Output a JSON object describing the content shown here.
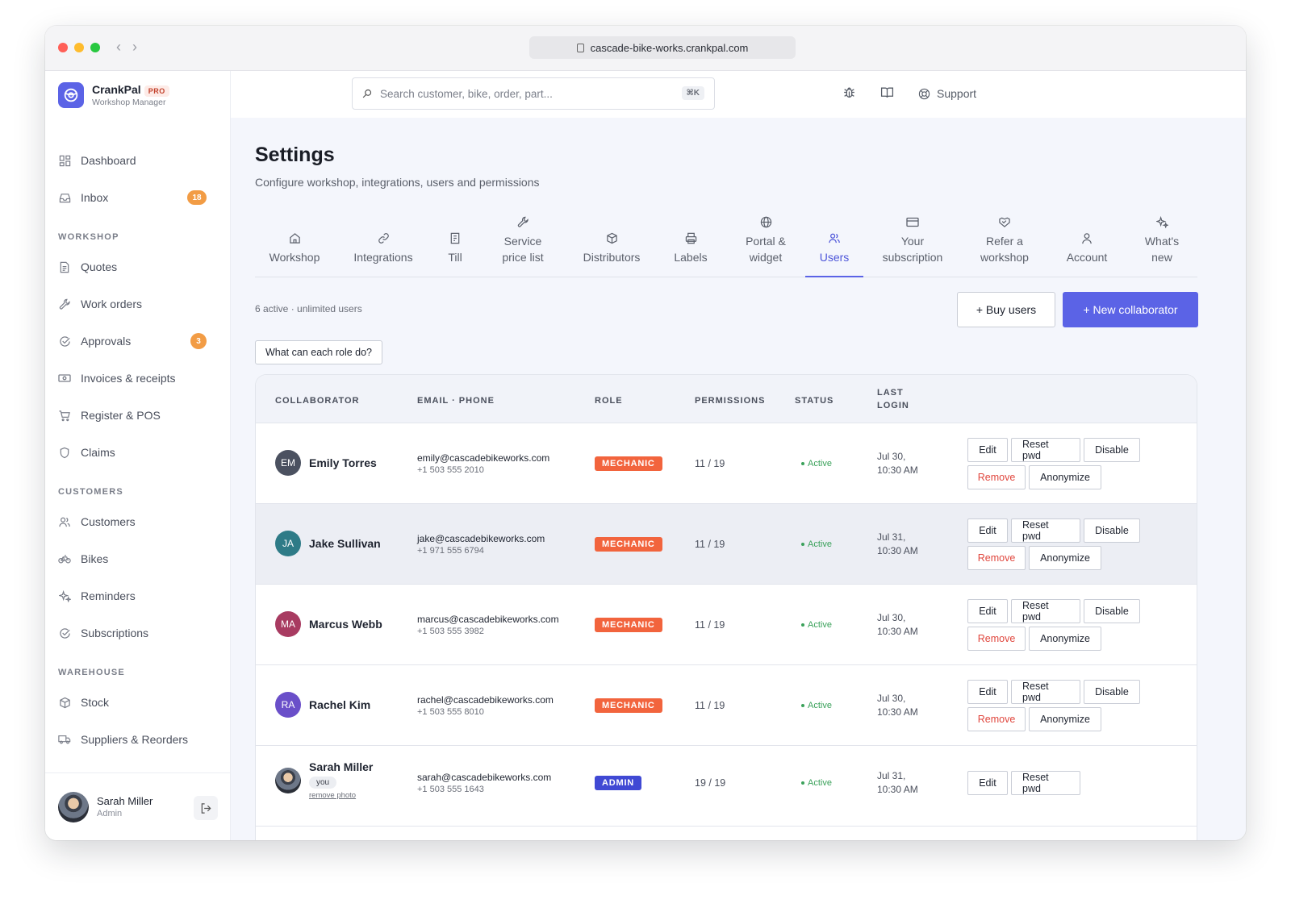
{
  "browser": {
    "url": "cascade-bike-works.crankpal.com",
    "traffic_colors": [
      "#ff5f57",
      "#febc2e",
      "#28c840"
    ]
  },
  "brand": {
    "name": "CrankPal",
    "badge": "PRO",
    "subtitle": "Workshop Manager",
    "accent": "#5b63e6"
  },
  "search": {
    "placeholder": "Search customer, bike, order, part...",
    "shortcut": "⌘K"
  },
  "topbar": {
    "support_label": "Support"
  },
  "sidebar": {
    "top_items": [
      {
        "label": "Dashboard",
        "icon": "grid-icon"
      },
      {
        "label": "Inbox",
        "icon": "inbox-icon",
        "badge": "18"
      }
    ],
    "sections": [
      {
        "title": "WORKSHOP",
        "items": [
          {
            "label": "Quotes",
            "icon": "document-icon"
          },
          {
            "label": "Work orders",
            "icon": "wrench-icon"
          },
          {
            "label": "Approvals",
            "icon": "check-circle-icon",
            "badge": "3"
          },
          {
            "label": "Invoices & receipts",
            "icon": "cash-icon"
          },
          {
            "label": "Register & POS",
            "icon": "cart-icon"
          },
          {
            "label": "Claims",
            "icon": "shield-icon"
          }
        ]
      },
      {
        "title": "CUSTOMERS",
        "items": [
          {
            "label": "Customers",
            "icon": "users-icon"
          },
          {
            "label": "Bikes",
            "icon": "bike-icon"
          },
          {
            "label": "Reminders",
            "icon": "sparkle-icon"
          },
          {
            "label": "Subscriptions",
            "icon": "check-circle-icon"
          }
        ]
      },
      {
        "title": "WAREHOUSE",
        "items": [
          {
            "label": "Stock",
            "icon": "box-icon"
          },
          {
            "label": "Suppliers & Reorders",
            "icon": "truck-icon"
          }
        ]
      }
    ],
    "profile": {
      "name": "Sarah Miller",
      "role": "Admin"
    }
  },
  "page": {
    "title": "Settings",
    "subtitle": "Configure workshop, integrations, users and permissions"
  },
  "tabs": [
    {
      "label": "Workshop",
      "icon": "home-icon"
    },
    {
      "label": "Integrations",
      "icon": "link-icon"
    },
    {
      "label": "Till",
      "icon": "receipt-icon"
    },
    {
      "label": "Service\nprice list",
      "icon": "wrench-icon"
    },
    {
      "label": "Distributors",
      "icon": "box-icon"
    },
    {
      "label": "Labels",
      "icon": "printer-icon"
    },
    {
      "label": "Portal &\nwidget",
      "icon": "globe-icon"
    },
    {
      "label": "Users",
      "icon": "users-icon",
      "active": true
    },
    {
      "label": "Your\nsubscription",
      "icon": "card-icon"
    },
    {
      "label": "Refer a\nworkshop",
      "icon": "handshake-icon"
    },
    {
      "label": "Account",
      "icon": "user-icon"
    },
    {
      "label": "What's\nnew",
      "icon": "sparkle-icon"
    }
  ],
  "users_panel": {
    "meta": "6 active · unlimited users",
    "buy_label": "+ Buy users",
    "new_label": "+ New collaborator",
    "role_help_label": "What can each role do?",
    "columns": {
      "collaborator": "COLLABORATOR",
      "email_phone": "EMAIL · PHONE",
      "role": "ROLE",
      "permissions": "PERMISSIONS",
      "status": "STATUS",
      "last_login": "LAST\nLOGIN"
    },
    "actions": {
      "edit": "Edit",
      "reset": "Reset pwd",
      "disable": "Disable",
      "remove": "Remove",
      "anonymize": "Anonymize"
    },
    "rows": [
      {
        "initials": "EM",
        "avatar_color": "#4b5160",
        "name": "Emily Torres",
        "email": "emily@cascadebikeworks.com",
        "phone": "+1 503 555 2010",
        "role": "MECHANIC",
        "role_color": "#f2643d",
        "permissions": "11 / 19",
        "status": "Active",
        "last_login": "Jul 30,\n10:30 AM"
      },
      {
        "initials": "JA",
        "avatar_color": "#2e7b87",
        "name": "Jake Sullivan",
        "email": "jake@cascadebikeworks.com",
        "phone": "+1 971 555 6794",
        "role": "MECHANIC",
        "role_color": "#f2643d",
        "permissions": "11 / 19",
        "status": "Active",
        "last_login": "Jul 31,\n10:30 AM"
      },
      {
        "initials": "MA",
        "avatar_color": "#a83b61",
        "name": "Marcus Webb",
        "email": "marcus@cascadebikeworks.com",
        "phone": "+1 503 555 3982",
        "role": "MECHANIC",
        "role_color": "#f2643d",
        "permissions": "11 / 19",
        "status": "Active",
        "last_login": "Jul 30,\n10:30 AM"
      },
      {
        "initials": "RA",
        "avatar_color": "#6a4fc9",
        "name": "Rachel Kim",
        "email": "rachel@cascadebikeworks.com",
        "phone": "+1 503 555 8010",
        "role": "MECHANIC",
        "role_color": "#f2643d",
        "permissions": "11 / 19",
        "status": "Active",
        "last_login": "Jul 30,\n10:30 AM"
      }
    ],
    "self_row": {
      "name": "Sarah Miller",
      "you": "you",
      "remove_photo": "remove photo",
      "email": "sarah@cascadebikeworks.com",
      "phone": "+1 503 555 1643",
      "role": "ADMIN",
      "role_color": "#4049d4",
      "permissions": "19 / 19",
      "status": "Active",
      "last_login": "Jul 31,\n10:30 AM"
    }
  }
}
